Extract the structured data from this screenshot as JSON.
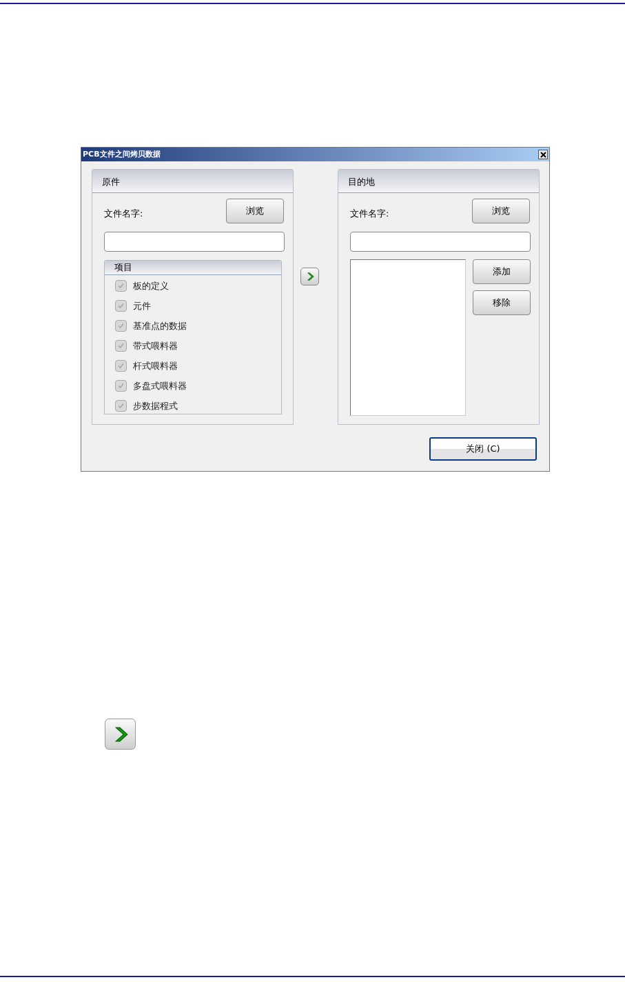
{
  "dialog": {
    "title": "PCB文件之间烤贝数据",
    "source": {
      "heading": "原件",
      "file_label": "文件名字:",
      "browse_button": "浏览",
      "items_group": {
        "heading": "项目",
        "items": [
          {
            "label": "板的定义",
            "checked": true,
            "disabled": true
          },
          {
            "label": "元件",
            "checked": true,
            "disabled": true
          },
          {
            "label": "基准点的数据",
            "checked": true,
            "disabled": true
          },
          {
            "label": "带式喂料器",
            "checked": true,
            "disabled": true
          },
          {
            "label": "杆式喂料器",
            "checked": true,
            "disabled": true
          },
          {
            "label": "多盘式喂料器",
            "checked": true,
            "disabled": true
          },
          {
            "label": "步数据程式",
            "checked": true,
            "disabled": true
          }
        ]
      }
    },
    "destination": {
      "heading": "目的地",
      "file_label": "文件名字:",
      "browse_button": "浏览",
      "buttons": [
        "添加",
        "移除"
      ]
    },
    "close_button": "关闭 (C)"
  }
}
